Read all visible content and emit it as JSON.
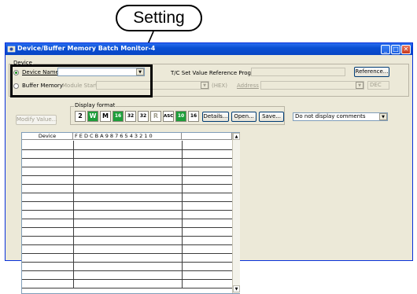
{
  "callout": {
    "label": "Setting"
  },
  "window": {
    "title": "Device/Buffer Memory Batch Monitor-4",
    "controls": {
      "minimize": "_",
      "maximize": "□",
      "close": "✕"
    }
  },
  "device_group": {
    "legend": "Device",
    "device_name": {
      "label": "Device Name",
      "value": ""
    },
    "buffer_memory": {
      "label": "Buffer Memory",
      "module_start_placeholder": "Module Start"
    },
    "tc_label": "T/C Set Value Reference Program",
    "reference_button": "Reference...",
    "hex_label": "(HEX)",
    "address_label": "Address",
    "dec_value": "DEC"
  },
  "display_format": {
    "legend": "Display format",
    "buttons": [
      "2",
      "W",
      "M",
      "16",
      "32",
      "32",
      "R",
      "ASC",
      "10",
      "16"
    ],
    "details": "Details...",
    "open": "Open...",
    "save": "Save..."
  },
  "modify_value": "Modify Value...",
  "comment_select": {
    "value": "Do not display comments"
  },
  "table": {
    "headers": [
      "Device",
      "F E D C B A 9 8 7 6 5 4 3 2 1 0",
      ""
    ],
    "row_count": 17
  }
}
